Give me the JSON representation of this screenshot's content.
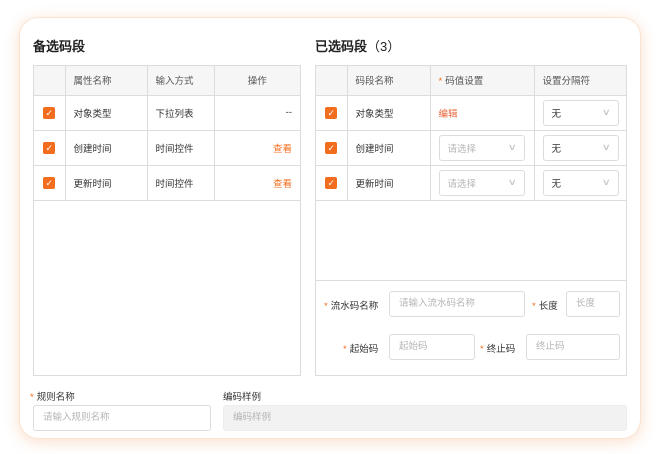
{
  "left_panel": {
    "title": "备选码段",
    "columns": [
      "属性名称",
      "输入方式",
      "操作"
    ],
    "rows": [
      {
        "name": "对象类型",
        "input": "下拉列表",
        "action": "--"
      },
      {
        "name": "创建时间",
        "input": "时间控件",
        "action": "查看"
      },
      {
        "name": "更新时间",
        "input": "时间控件",
        "action": "查看"
      }
    ]
  },
  "right_panel": {
    "title": "已选码段",
    "count": "（3）",
    "columns": [
      "码段名称",
      "码值设置",
      "设置分隔符"
    ],
    "rows": [
      {
        "name": "对象类型",
        "value_link": "编辑",
        "separator": "无"
      },
      {
        "name": "创建时间",
        "value_placeholder": "请选择",
        "separator": "无"
      },
      {
        "name": "更新时间",
        "value_placeholder": "请选择",
        "separator": "无"
      }
    ],
    "serial_form": {
      "serial_name_label": "流水码名称",
      "serial_name_placeholder": "请输入流水码名称",
      "length_label": "长度",
      "length_placeholder": "长度",
      "start_label": "起始码",
      "start_placeholder": "起始码",
      "end_label": "终止码",
      "end_placeholder": "终止码"
    }
  },
  "bottom": {
    "rule_name_label": "规则名称",
    "rule_name_placeholder": "请输入规则名称",
    "sample_label": "编码样例",
    "sample_placeholder": "编码样例"
  },
  "required_mark": "*",
  "check_glyph": "✓",
  "chevron_glyph": "∨",
  "colors": {
    "accent": "#f36d1f",
    "border": "#dcdcdc",
    "header_bg": "#f6f6f6"
  }
}
